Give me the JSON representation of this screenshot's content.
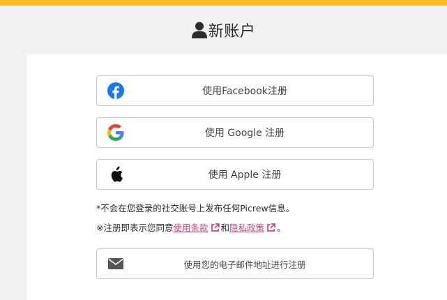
{
  "colors": {
    "accent_bar": "#fbbd1f",
    "link": "#d6457a",
    "facebook_blue": "#1877f2",
    "border": "#c9c9c9"
  },
  "header": {
    "title": "新账户",
    "icon": "user-icon"
  },
  "buttons": {
    "facebook": {
      "label": "使用Facebook注册",
      "icon": "facebook-icon"
    },
    "google": {
      "label": "使用 Google 注册",
      "icon": "google-icon"
    },
    "apple": {
      "label": "使用 Apple 注册",
      "icon": "apple-icon"
    },
    "email": {
      "label": "使用您的电子邮件地址进行注册",
      "icon": "envelope-icon"
    }
  },
  "notices": {
    "privacy": "*不会在您登录的社交账号上发布任何Picrew信息。",
    "agreement_prefix": "※注册即表示您同意",
    "terms_link": "使用条款",
    "and_text": "和",
    "policy_link": "隐私政策",
    "suffix": "。"
  }
}
